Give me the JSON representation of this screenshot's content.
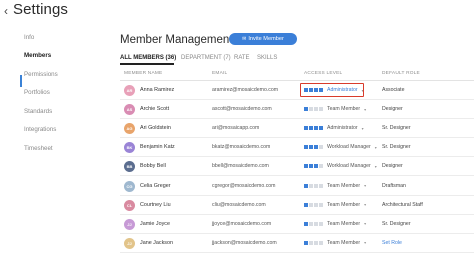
{
  "page": {
    "title": "Settings"
  },
  "sidebar": {
    "items": [
      {
        "label": "Info"
      },
      {
        "label": "Members"
      },
      {
        "label": "Permissions"
      },
      {
        "label": "Portfolios"
      },
      {
        "label": "Standards"
      },
      {
        "label": "Integrations"
      },
      {
        "label": "Timesheet"
      }
    ],
    "active": "Members"
  },
  "main": {
    "heading": "Member Management",
    "invite_label": "Invite Member",
    "tabs": [
      {
        "label": "ALL MEMBERS (36)"
      },
      {
        "label": "DEPARTMENT (7)"
      },
      {
        "label": "RATE"
      },
      {
        "label": "SKILLS"
      }
    ],
    "columns": {
      "name": "MEMBER NAME",
      "email": "EMAIL",
      "access": "ACCESS LEVEL",
      "role": "DEFAULT ROLE"
    },
    "members": [
      {
        "initials": "AR",
        "name": "Anna Ramirez",
        "email": "aramirez@mosaicdemo.com",
        "access": "Administrator",
        "level": 4,
        "role": "Associate",
        "avatar_color": "#e8a0b8",
        "highlighted": true
      },
      {
        "initials": "AS",
        "name": "Archie Scott",
        "email": "ascott@mosaicdemo.com",
        "access": "Team Member",
        "level": 1,
        "role": "Designer",
        "avatar_color": "#d98cb3"
      },
      {
        "initials": "AG",
        "name": "Ari Goldstein",
        "email": "ari@mosaicapp.com",
        "access": "Administrator",
        "level": 4,
        "role": "Sr. Designer",
        "avatar_color": "#e8a46b"
      },
      {
        "initials": "BK",
        "name": "Benjamin Katz",
        "email": "bkatz@mosaicdemo.com",
        "access": "Workload Manager",
        "level": 3,
        "role": "Sr. Designer",
        "avatar_color": "#9a84d6"
      },
      {
        "initials": "BB",
        "name": "Bobby Bell",
        "email": "bbell@mosaicdemo.com",
        "access": "Workload Manager",
        "level": 3,
        "role": "Designer",
        "avatar_color": "#5b6d8f"
      },
      {
        "initials": "CG",
        "name": "Celia Greger",
        "email": "cgregor@mosaicdemo.com",
        "access": "Team Member",
        "level": 1,
        "role": "Draftsman",
        "avatar_color": "#9fb8cf"
      },
      {
        "initials": "CL",
        "name": "Courtney Liu",
        "email": "cliu@mosaicdemo.com",
        "access": "Team Member",
        "level": 1,
        "role": "Architectural Staff",
        "avatar_color": "#d98aa0"
      },
      {
        "initials": "JJ",
        "name": "Jamie Joyce",
        "email": "jjoyce@mosaicdemo.com",
        "access": "Team Member",
        "level": 1,
        "role": "Sr. Designer",
        "avatar_color": "#c79ad6"
      },
      {
        "initials": "JJ",
        "name": "Jane Jackson",
        "email": "jjackson@mosaicdemo.com",
        "access": "Team Member",
        "level": 1,
        "role": "Set Role",
        "role_is_link": true,
        "avatar_color": "#e2c48a"
      }
    ]
  }
}
